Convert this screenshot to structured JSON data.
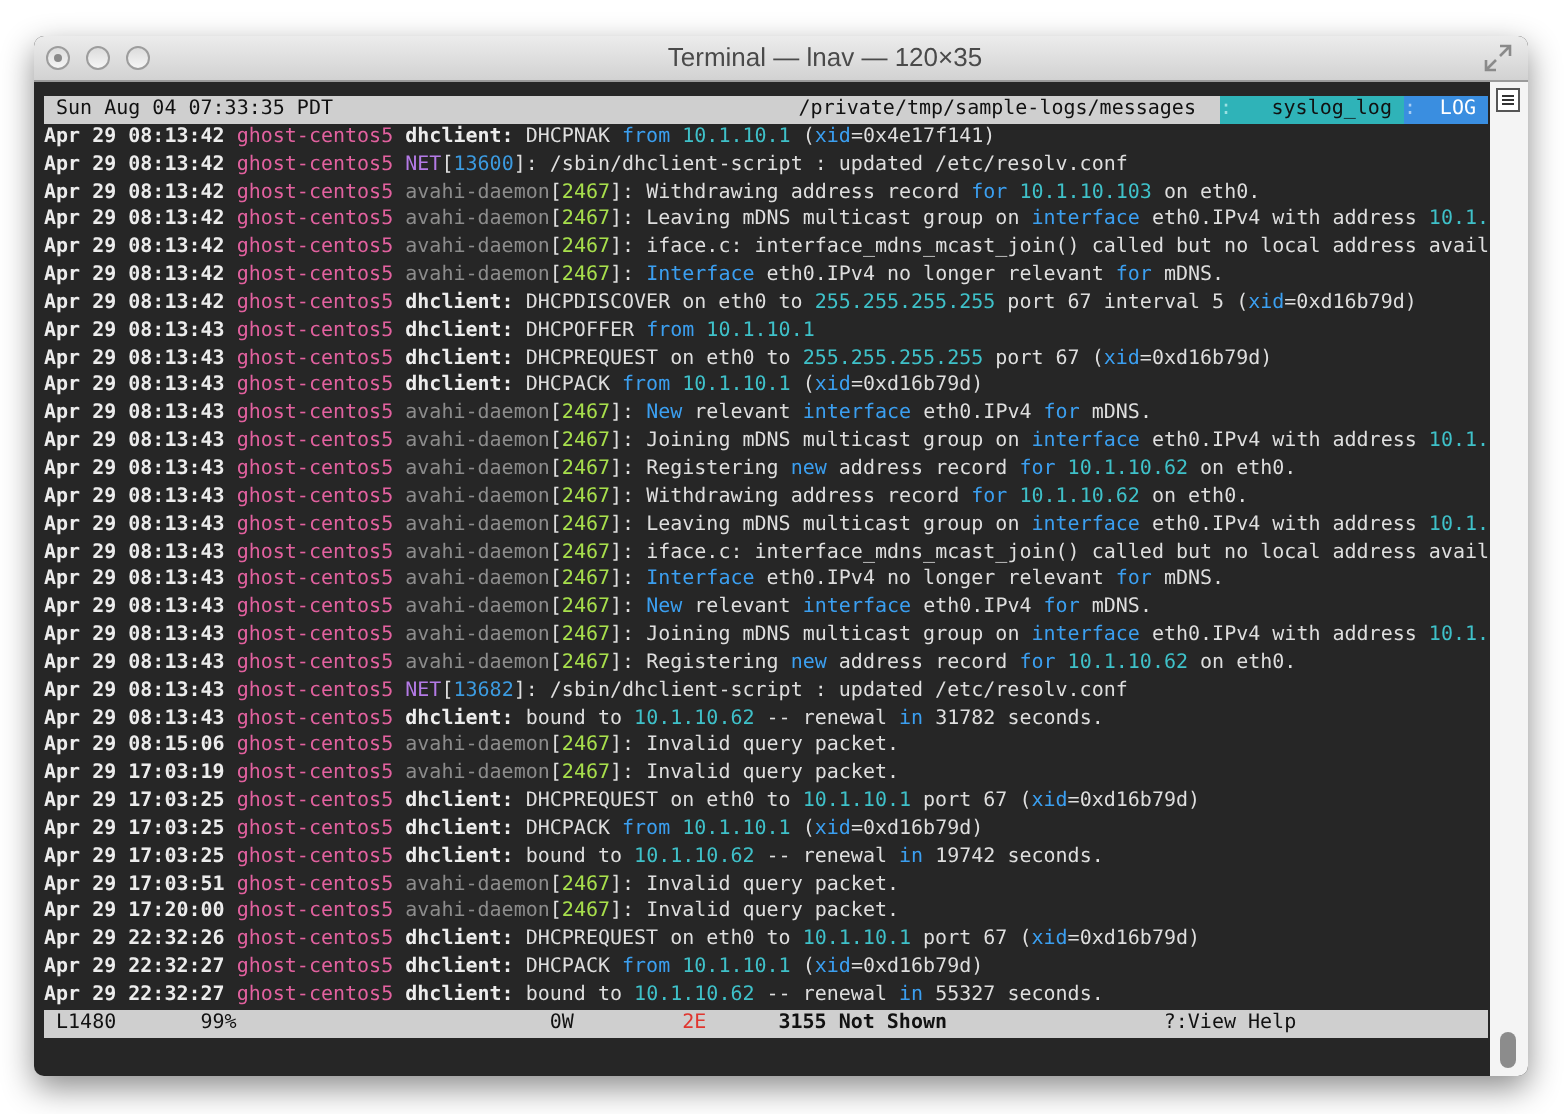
{
  "window": {
    "title": "Terminal — lnav — 120×35"
  },
  "top_bar": {
    "clock": "Sun Aug 04 07:33:35 PDT",
    "path": "/private/tmp/sample-logs/messages",
    "format_sep": ":",
    "format": "syslog_log",
    "view_sep": ":",
    "view": "LOG"
  },
  "log_lines": [
    {
      "segments": [
        {
          "text": "Apr 29 08:13:42",
          "kind": "time"
        },
        {
          "text": " ghost-centos5",
          "kind": "host"
        },
        {
          "text": " dhclient:",
          "kind": "dhclient"
        },
        {
          "text": " DHCPNAK ",
          "kind": "plain"
        },
        {
          "text": "from",
          "kind": "keyword"
        },
        {
          "text": " 10.1.10.1",
          "kind": "number"
        },
        {
          "text": " (",
          "kind": "plain"
        },
        {
          "text": "xid",
          "kind": "keyword"
        },
        {
          "text": "=0x4e17f141)",
          "kind": "plain"
        }
      ]
    },
    {
      "segments": [
        {
          "text": "Apr 29 08:13:42",
          "kind": "time"
        },
        {
          "text": " ghost-centos5",
          "kind": "host"
        },
        {
          "text": " NET",
          "kind": "net"
        },
        {
          "text": "[",
          "kind": "plain"
        },
        {
          "text": "13600",
          "kind": "net_pid"
        },
        {
          "text": "]: /sbin/dhclient-script : updated /etc/resolv.conf",
          "kind": "plain"
        }
      ]
    },
    {
      "segments": [
        {
          "text": "Apr 29 08:13:42",
          "kind": "time"
        },
        {
          "text": " ghost-centos5",
          "kind": "host"
        },
        {
          "text": " avahi-daemon",
          "kind": "avahi"
        },
        {
          "text": "[",
          "kind": "plain"
        },
        {
          "text": "2467",
          "kind": "pid"
        },
        {
          "text": "]: Withdrawing address record ",
          "kind": "plain"
        },
        {
          "text": "for",
          "kind": "keyword"
        },
        {
          "text": " 10.1.10.103",
          "kind": "number"
        },
        {
          "text": " on eth0.",
          "kind": "plain"
        }
      ]
    },
    {
      "segments": [
        {
          "text": "Apr 29 08:13:42",
          "kind": "time"
        },
        {
          "text": " ghost-centos5",
          "kind": "host"
        },
        {
          "text": " avahi-daemon",
          "kind": "avahi"
        },
        {
          "text": "[",
          "kind": "plain"
        },
        {
          "text": "2467",
          "kind": "pid"
        },
        {
          "text": "]: Leaving mDNS multicast group on ",
          "kind": "plain"
        },
        {
          "text": "interface",
          "kind": "keyword"
        },
        {
          "text": " eth0.IPv4 with address ",
          "kind": "plain"
        },
        {
          "text": "10.1.",
          "kind": "number"
        }
      ]
    },
    {
      "segments": [
        {
          "text": "Apr 29 08:13:42",
          "kind": "time"
        },
        {
          "text": " ghost-centos5",
          "kind": "host"
        },
        {
          "text": " avahi-daemon",
          "kind": "avahi"
        },
        {
          "text": "[",
          "kind": "plain"
        },
        {
          "text": "2467",
          "kind": "pid"
        },
        {
          "text": "]: iface.c: interface_mdns_mcast_join() called but no local address avail",
          "kind": "plain"
        }
      ]
    },
    {
      "segments": [
        {
          "text": "Apr 29 08:13:42",
          "kind": "time"
        },
        {
          "text": " ghost-centos5",
          "kind": "host"
        },
        {
          "text": " avahi-daemon",
          "kind": "avahi"
        },
        {
          "text": "[",
          "kind": "plain"
        },
        {
          "text": "2467",
          "kind": "pid"
        },
        {
          "text": "]: ",
          "kind": "plain"
        },
        {
          "text": "Interface",
          "kind": "keyword"
        },
        {
          "text": " eth0.IPv4 no longer relevant ",
          "kind": "plain"
        },
        {
          "text": "for",
          "kind": "keyword"
        },
        {
          "text": " mDNS.",
          "kind": "plain"
        }
      ]
    },
    {
      "segments": [
        {
          "text": "Apr 29 08:13:42",
          "kind": "time"
        },
        {
          "text": " ghost-centos5",
          "kind": "host"
        },
        {
          "text": " dhclient:",
          "kind": "dhclient"
        },
        {
          "text": " DHCPDISCOVER on eth0 to ",
          "kind": "plain"
        },
        {
          "text": "255.255.255.255",
          "kind": "number"
        },
        {
          "text": " port 67 interval 5 (",
          "kind": "plain"
        },
        {
          "text": "xid",
          "kind": "keyword"
        },
        {
          "text": "=0xd16b79d)",
          "kind": "plain"
        }
      ]
    },
    {
      "segments": [
        {
          "text": "Apr 29 08:13:43",
          "kind": "time"
        },
        {
          "text": " ghost-centos5",
          "kind": "host"
        },
        {
          "text": " dhclient:",
          "kind": "dhclient"
        },
        {
          "text": " DHCPOFFER ",
          "kind": "plain"
        },
        {
          "text": "from",
          "kind": "keyword"
        },
        {
          "text": " 10.1.10.1",
          "kind": "number"
        }
      ]
    },
    {
      "segments": [
        {
          "text": "Apr 29 08:13:43",
          "kind": "time"
        },
        {
          "text": " ghost-centos5",
          "kind": "host"
        },
        {
          "text": " dhclient:",
          "kind": "dhclient"
        },
        {
          "text": " DHCPREQUEST on eth0 to ",
          "kind": "plain"
        },
        {
          "text": "255.255.255.255",
          "kind": "number"
        },
        {
          "text": " port 67 (",
          "kind": "plain"
        },
        {
          "text": "xid",
          "kind": "keyword"
        },
        {
          "text": "=0xd16b79d)",
          "kind": "plain"
        }
      ]
    },
    {
      "segments": [
        {
          "text": "Apr 29 08:13:43",
          "kind": "time"
        },
        {
          "text": " ghost-centos5",
          "kind": "host"
        },
        {
          "text": " dhclient:",
          "kind": "dhclient"
        },
        {
          "text": " DHCPACK ",
          "kind": "plain"
        },
        {
          "text": "from",
          "kind": "keyword"
        },
        {
          "text": " 10.1.10.1",
          "kind": "number"
        },
        {
          "text": " (",
          "kind": "plain"
        },
        {
          "text": "xid",
          "kind": "keyword"
        },
        {
          "text": "=0xd16b79d)",
          "kind": "plain"
        }
      ]
    },
    {
      "segments": [
        {
          "text": "Apr 29 08:13:43",
          "kind": "time"
        },
        {
          "text": " ghost-centos5",
          "kind": "host"
        },
        {
          "text": " avahi-daemon",
          "kind": "avahi"
        },
        {
          "text": "[",
          "kind": "plain"
        },
        {
          "text": "2467",
          "kind": "pid"
        },
        {
          "text": "]: ",
          "kind": "plain"
        },
        {
          "text": "New",
          "kind": "keyword"
        },
        {
          "text": " relevant ",
          "kind": "plain"
        },
        {
          "text": "interface",
          "kind": "keyword"
        },
        {
          "text": " eth0.IPv4 ",
          "kind": "plain"
        },
        {
          "text": "for",
          "kind": "keyword"
        },
        {
          "text": " mDNS.",
          "kind": "plain"
        }
      ]
    },
    {
      "segments": [
        {
          "text": "Apr 29 08:13:43",
          "kind": "time"
        },
        {
          "text": " ghost-centos5",
          "kind": "host"
        },
        {
          "text": " avahi-daemon",
          "kind": "avahi"
        },
        {
          "text": "[",
          "kind": "plain"
        },
        {
          "text": "2467",
          "kind": "pid"
        },
        {
          "text": "]: Joining mDNS multicast group on ",
          "kind": "plain"
        },
        {
          "text": "interface",
          "kind": "keyword"
        },
        {
          "text": " eth0.IPv4 with address ",
          "kind": "plain"
        },
        {
          "text": "10.1.",
          "kind": "number"
        }
      ]
    },
    {
      "segments": [
        {
          "text": "Apr 29 08:13:43",
          "kind": "time"
        },
        {
          "text": " ghost-centos5",
          "kind": "host"
        },
        {
          "text": " avahi-daemon",
          "kind": "avahi"
        },
        {
          "text": "[",
          "kind": "plain"
        },
        {
          "text": "2467",
          "kind": "pid"
        },
        {
          "text": "]: Registering ",
          "kind": "plain"
        },
        {
          "text": "new",
          "kind": "keyword"
        },
        {
          "text": " address record ",
          "kind": "plain"
        },
        {
          "text": "for",
          "kind": "keyword"
        },
        {
          "text": " 10.1.10.62",
          "kind": "number"
        },
        {
          "text": " on eth0.",
          "kind": "plain"
        }
      ]
    },
    {
      "segments": [
        {
          "text": "Apr 29 08:13:43",
          "kind": "time"
        },
        {
          "text": " ghost-centos5",
          "kind": "host"
        },
        {
          "text": " avahi-daemon",
          "kind": "avahi"
        },
        {
          "text": "[",
          "kind": "plain"
        },
        {
          "text": "2467",
          "kind": "pid"
        },
        {
          "text": "]: Withdrawing address record ",
          "kind": "plain"
        },
        {
          "text": "for",
          "kind": "keyword"
        },
        {
          "text": " 10.1.10.62",
          "kind": "number"
        },
        {
          "text": " on eth0.",
          "kind": "plain"
        }
      ]
    },
    {
      "segments": [
        {
          "text": "Apr 29 08:13:43",
          "kind": "time"
        },
        {
          "text": " ghost-centos5",
          "kind": "host"
        },
        {
          "text": " avahi-daemon",
          "kind": "avahi"
        },
        {
          "text": "[",
          "kind": "plain"
        },
        {
          "text": "2467",
          "kind": "pid"
        },
        {
          "text": "]: Leaving mDNS multicast group on ",
          "kind": "plain"
        },
        {
          "text": "interface",
          "kind": "keyword"
        },
        {
          "text": " eth0.IPv4 with address ",
          "kind": "plain"
        },
        {
          "text": "10.1.",
          "kind": "number"
        }
      ]
    },
    {
      "segments": [
        {
          "text": "Apr 29 08:13:43",
          "kind": "time"
        },
        {
          "text": " ghost-centos5",
          "kind": "host"
        },
        {
          "text": " avahi-daemon",
          "kind": "avahi"
        },
        {
          "text": "[",
          "kind": "plain"
        },
        {
          "text": "2467",
          "kind": "pid"
        },
        {
          "text": "]: iface.c: interface_mdns_mcast_join() called but no local address avail",
          "kind": "plain"
        }
      ]
    },
    {
      "segments": [
        {
          "text": "Apr 29 08:13:43",
          "kind": "time"
        },
        {
          "text": " ghost-centos5",
          "kind": "host"
        },
        {
          "text": " avahi-daemon",
          "kind": "avahi"
        },
        {
          "text": "[",
          "kind": "plain"
        },
        {
          "text": "2467",
          "kind": "pid"
        },
        {
          "text": "]: ",
          "kind": "plain"
        },
        {
          "text": "Interface",
          "kind": "keyword"
        },
        {
          "text": " eth0.IPv4 no longer relevant ",
          "kind": "plain"
        },
        {
          "text": "for",
          "kind": "keyword"
        },
        {
          "text": " mDNS.",
          "kind": "plain"
        }
      ]
    },
    {
      "segments": [
        {
          "text": "Apr 29 08:13:43",
          "kind": "time"
        },
        {
          "text": " ghost-centos5",
          "kind": "host"
        },
        {
          "text": " avahi-daemon",
          "kind": "avahi"
        },
        {
          "text": "[",
          "kind": "plain"
        },
        {
          "text": "2467",
          "kind": "pid"
        },
        {
          "text": "]: ",
          "kind": "plain"
        },
        {
          "text": "New",
          "kind": "keyword"
        },
        {
          "text": " relevant ",
          "kind": "plain"
        },
        {
          "text": "interface",
          "kind": "keyword"
        },
        {
          "text": " eth0.IPv4 ",
          "kind": "plain"
        },
        {
          "text": "for",
          "kind": "keyword"
        },
        {
          "text": " mDNS.",
          "kind": "plain"
        }
      ]
    },
    {
      "segments": [
        {
          "text": "Apr 29 08:13:43",
          "kind": "time"
        },
        {
          "text": " ghost-centos5",
          "kind": "host"
        },
        {
          "text": " avahi-daemon",
          "kind": "avahi"
        },
        {
          "text": "[",
          "kind": "plain"
        },
        {
          "text": "2467",
          "kind": "pid"
        },
        {
          "text": "]: Joining mDNS multicast group on ",
          "kind": "plain"
        },
        {
          "text": "interface",
          "kind": "keyword"
        },
        {
          "text": " eth0.IPv4 with address ",
          "kind": "plain"
        },
        {
          "text": "10.1.",
          "kind": "number"
        }
      ]
    },
    {
      "segments": [
        {
          "text": "Apr 29 08:13:43",
          "kind": "time"
        },
        {
          "text": " ghost-centos5",
          "kind": "host"
        },
        {
          "text": " avahi-daemon",
          "kind": "avahi"
        },
        {
          "text": "[",
          "kind": "plain"
        },
        {
          "text": "2467",
          "kind": "pid"
        },
        {
          "text": "]: Registering ",
          "kind": "plain"
        },
        {
          "text": "new",
          "kind": "keyword"
        },
        {
          "text": " address record ",
          "kind": "plain"
        },
        {
          "text": "for",
          "kind": "keyword"
        },
        {
          "text": " 10.1.10.62",
          "kind": "number"
        },
        {
          "text": " on eth0.",
          "kind": "plain"
        }
      ]
    },
    {
      "segments": [
        {
          "text": "Apr 29 08:13:43",
          "kind": "time"
        },
        {
          "text": " ghost-centos5",
          "kind": "host"
        },
        {
          "text": " NET",
          "kind": "net"
        },
        {
          "text": "[",
          "kind": "plain"
        },
        {
          "text": "13682",
          "kind": "net_pid"
        },
        {
          "text": "]: /sbin/dhclient-script : updated /etc/resolv.conf",
          "kind": "plain"
        }
      ]
    },
    {
      "segments": [
        {
          "text": "Apr 29 08:13:43",
          "kind": "time"
        },
        {
          "text": " ghost-centos5",
          "kind": "host"
        },
        {
          "text": " dhclient:",
          "kind": "dhclient"
        },
        {
          "text": " bound to ",
          "kind": "plain"
        },
        {
          "text": "10.1.10.62",
          "kind": "number"
        },
        {
          "text": " -- renewal ",
          "kind": "plain"
        },
        {
          "text": "in",
          "kind": "keyword"
        },
        {
          "text": " 31782 seconds.",
          "kind": "plain"
        }
      ]
    },
    {
      "segments": [
        {
          "text": "Apr 29 08:15:06",
          "kind": "time"
        },
        {
          "text": " ghost-centos5",
          "kind": "host"
        },
        {
          "text": " avahi-daemon",
          "kind": "avahi"
        },
        {
          "text": "[",
          "kind": "plain"
        },
        {
          "text": "2467",
          "kind": "pid"
        },
        {
          "text": "]: Invalid query packet.",
          "kind": "plain"
        }
      ]
    },
    {
      "segments": [
        {
          "text": "Apr 29 17:03:19",
          "kind": "time"
        },
        {
          "text": " ghost-centos5",
          "kind": "host"
        },
        {
          "text": " avahi-daemon",
          "kind": "avahi"
        },
        {
          "text": "[",
          "kind": "plain"
        },
        {
          "text": "2467",
          "kind": "pid"
        },
        {
          "text": "]: Invalid query packet.",
          "kind": "plain"
        }
      ]
    },
    {
      "segments": [
        {
          "text": "Apr 29 17:03:25",
          "kind": "time"
        },
        {
          "text": " ghost-centos5",
          "kind": "host"
        },
        {
          "text": " dhclient:",
          "kind": "dhclient"
        },
        {
          "text": " DHCPREQUEST on eth0 to ",
          "kind": "plain"
        },
        {
          "text": "10.1.10.1",
          "kind": "number"
        },
        {
          "text": " port 67 (",
          "kind": "plain"
        },
        {
          "text": "xid",
          "kind": "keyword"
        },
        {
          "text": "=0xd16b79d)",
          "kind": "plain"
        }
      ]
    },
    {
      "segments": [
        {
          "text": "Apr 29 17:03:25",
          "kind": "time"
        },
        {
          "text": " ghost-centos5",
          "kind": "host"
        },
        {
          "text": " dhclient:",
          "kind": "dhclient"
        },
        {
          "text": " DHCPACK ",
          "kind": "plain"
        },
        {
          "text": "from",
          "kind": "keyword"
        },
        {
          "text": " 10.1.10.1",
          "kind": "number"
        },
        {
          "text": " (",
          "kind": "plain"
        },
        {
          "text": "xid",
          "kind": "keyword"
        },
        {
          "text": "=0xd16b79d)",
          "kind": "plain"
        }
      ]
    },
    {
      "segments": [
        {
          "text": "Apr 29 17:03:25",
          "kind": "time"
        },
        {
          "text": " ghost-centos5",
          "kind": "host"
        },
        {
          "text": " dhclient:",
          "kind": "dhclient"
        },
        {
          "text": " bound to ",
          "kind": "plain"
        },
        {
          "text": "10.1.10.62",
          "kind": "number"
        },
        {
          "text": " -- renewal ",
          "kind": "plain"
        },
        {
          "text": "in",
          "kind": "keyword"
        },
        {
          "text": " 19742 seconds.",
          "kind": "plain"
        }
      ]
    },
    {
      "segments": [
        {
          "text": "Apr 29 17:03:51",
          "kind": "time"
        },
        {
          "text": " ghost-centos5",
          "kind": "host"
        },
        {
          "text": " avahi-daemon",
          "kind": "avahi"
        },
        {
          "text": "[",
          "kind": "plain"
        },
        {
          "text": "2467",
          "kind": "pid"
        },
        {
          "text": "]: Invalid query packet.",
          "kind": "plain"
        }
      ]
    },
    {
      "segments": [
        {
          "text": "Apr 29 17:20:00",
          "kind": "time"
        },
        {
          "text": " ghost-centos5",
          "kind": "host"
        },
        {
          "text": " avahi-daemon",
          "kind": "avahi"
        },
        {
          "text": "[",
          "kind": "plain"
        },
        {
          "text": "2467",
          "kind": "pid"
        },
        {
          "text": "]: Invalid query packet.",
          "kind": "plain"
        }
      ]
    },
    {
      "segments": [
        {
          "text": "Apr 29 22:32:26",
          "kind": "time"
        },
        {
          "text": " ghost-centos5",
          "kind": "host"
        },
        {
          "text": " dhclient:",
          "kind": "dhclient"
        },
        {
          "text": " DHCPREQUEST on eth0 to ",
          "kind": "plain"
        },
        {
          "text": "10.1.10.1",
          "kind": "number"
        },
        {
          "text": " port 67 (",
          "kind": "plain"
        },
        {
          "text": "xid",
          "kind": "keyword"
        },
        {
          "text": "=0xd16b79d)",
          "kind": "plain"
        }
      ]
    },
    {
      "segments": [
        {
          "text": "Apr 29 22:32:27",
          "kind": "time"
        },
        {
          "text": " ghost-centos5",
          "kind": "host"
        },
        {
          "text": " dhclient:",
          "kind": "dhclient"
        },
        {
          "text": " DHCPACK ",
          "kind": "plain"
        },
        {
          "text": "from",
          "kind": "keyword"
        },
        {
          "text": " 10.1.10.1",
          "kind": "number"
        },
        {
          "text": " (",
          "kind": "plain"
        },
        {
          "text": "xid",
          "kind": "keyword"
        },
        {
          "text": "=0xd16b79d)",
          "kind": "plain"
        }
      ]
    },
    {
      "segments": [
        {
          "text": "Apr 29 22:32:27",
          "kind": "time"
        },
        {
          "text": " ghost-centos5",
          "kind": "host"
        },
        {
          "text": " dhclient:",
          "kind": "dhclient"
        },
        {
          "text": " bound to ",
          "kind": "plain"
        },
        {
          "text": "10.1.10.62",
          "kind": "number"
        },
        {
          "text": " -- renewal ",
          "kind": "plain"
        },
        {
          "text": "in",
          "kind": "keyword"
        },
        {
          "text": " 55327 seconds.",
          "kind": "plain"
        }
      ]
    }
  ],
  "status_bar": {
    "line": "L1480",
    "percent": "99%",
    "warnings": "0W",
    "errors": "2E",
    "not_shown": "3155 Not Shown",
    "help": "?:View Help"
  }
}
